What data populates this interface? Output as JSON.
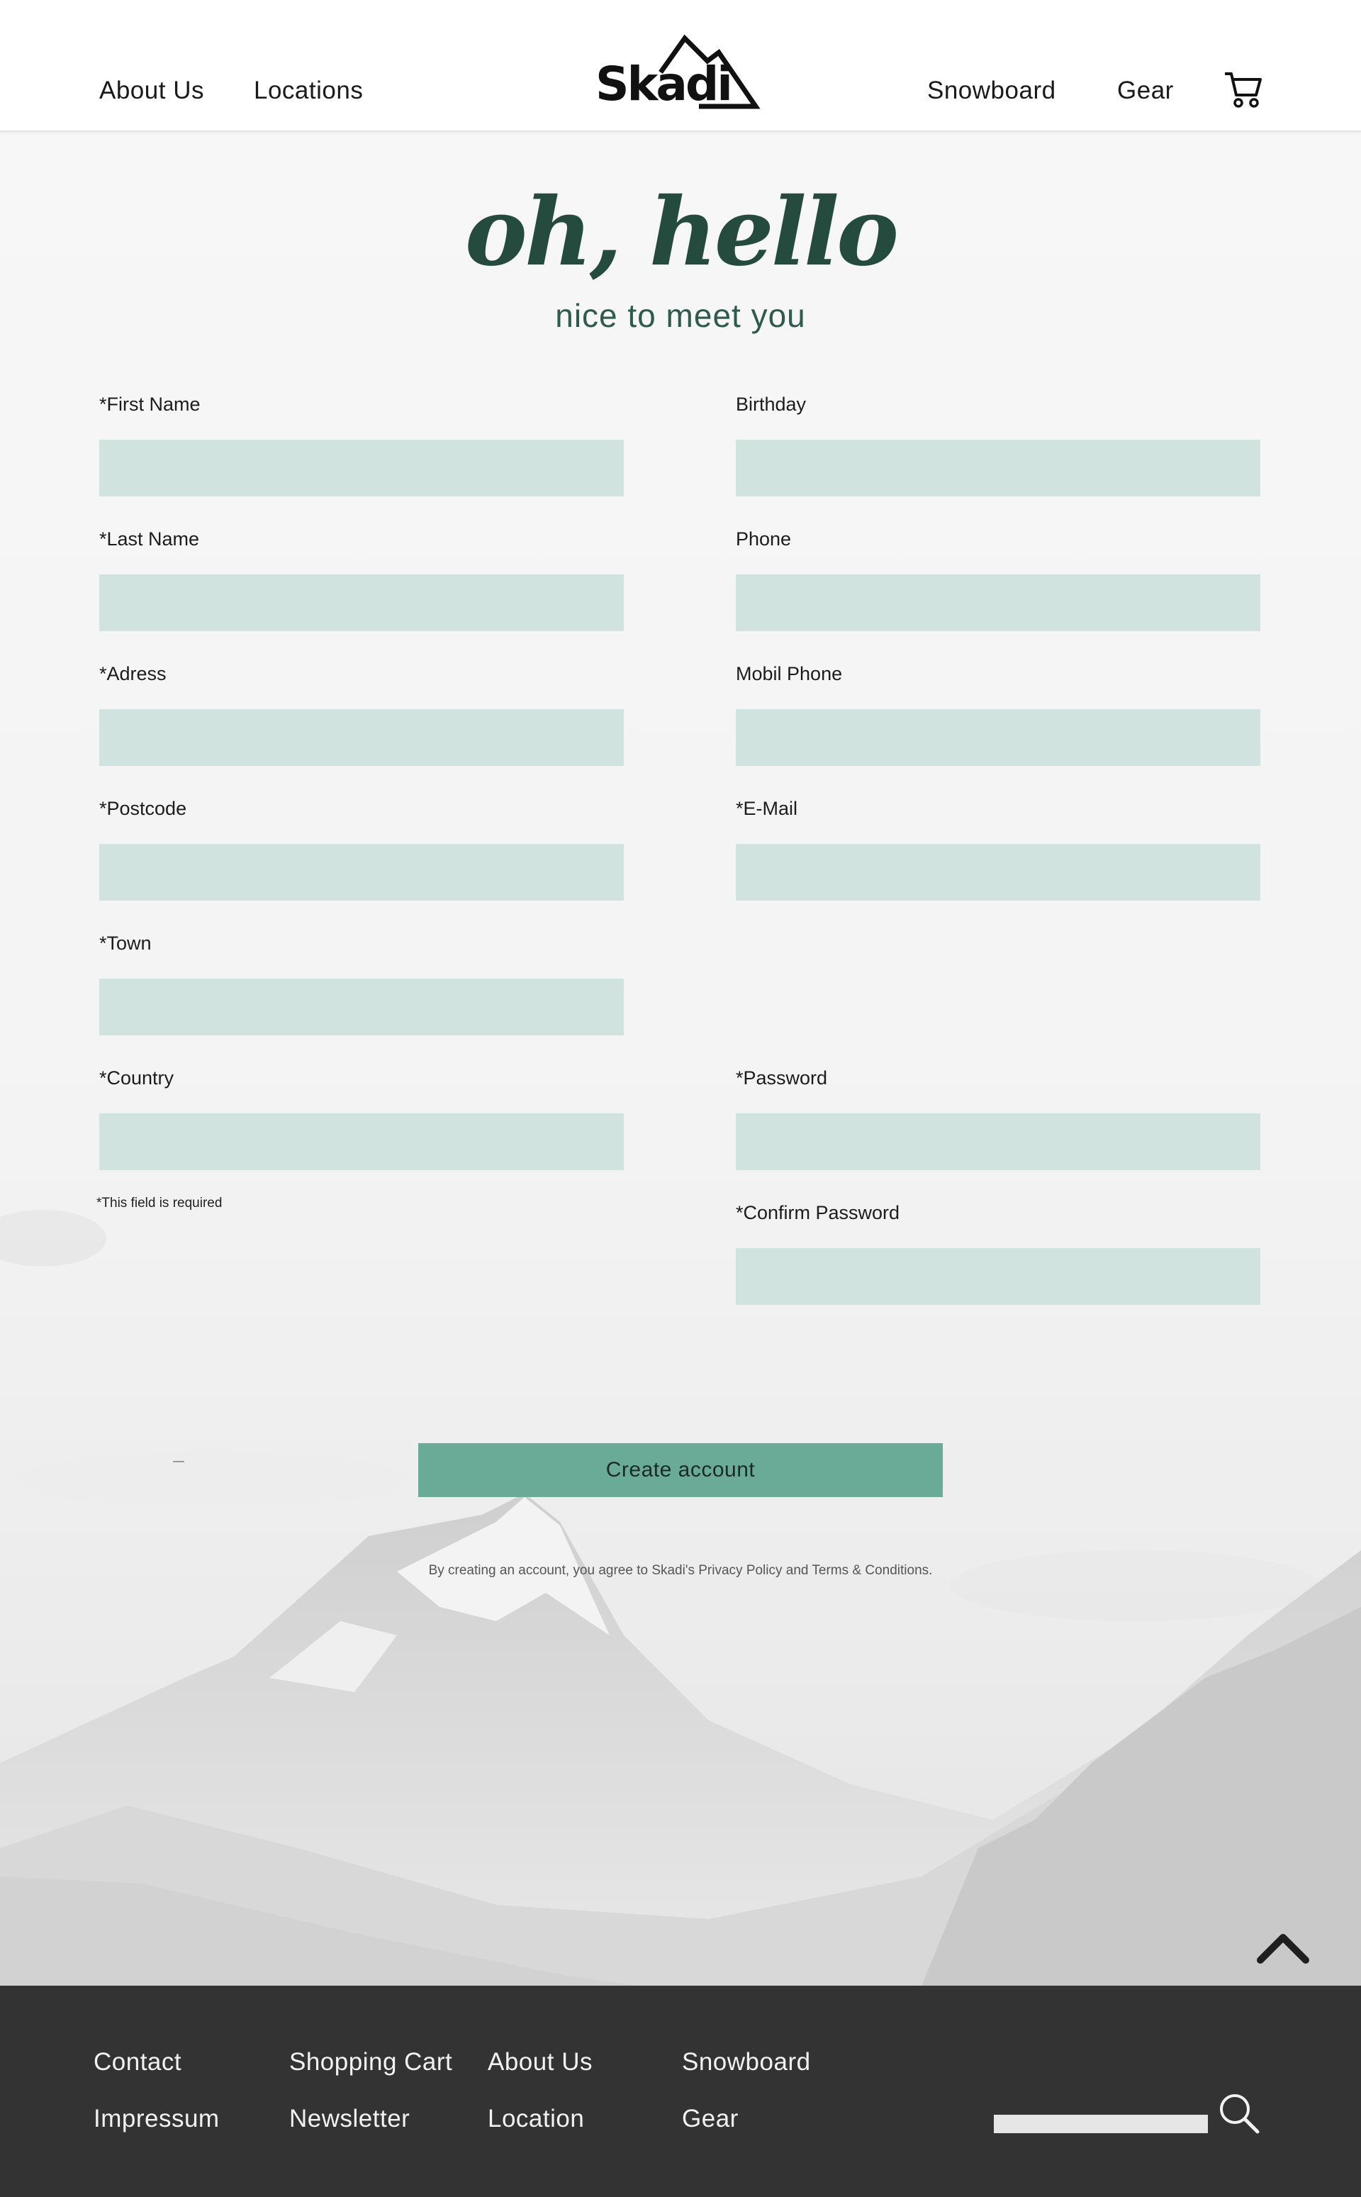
{
  "header": {
    "nav_left": [
      "About Us",
      "Locations"
    ],
    "logo_text": "Skadi",
    "nav_right": [
      "Snowboard",
      "Gear"
    ],
    "cart_icon": "shopping-cart-icon"
  },
  "hero": {
    "title": "oh, hello",
    "subtitle": "nice to meet you"
  },
  "form": {
    "first_name": "*First Name",
    "last_name": "*Last Name",
    "address": "*Adress",
    "postcode": "*Postcode",
    "town": "*Town",
    "country": "*Country",
    "birthday": "Birthday",
    "phone": "Phone",
    "mobile": "Mobil Phone",
    "email": "*E-Mail",
    "password": "*Password",
    "confirm_password": "*Confirm Password",
    "required_note": "*This field is required",
    "submit_label": "Create account",
    "terms": "By creating an account, you agree to Skadi's Privacy Policy and Terms & Conditions."
  },
  "footer": {
    "links": [
      "Contact",
      "Shopping Cart",
      "About Us",
      "Snowboard",
      "Impressum",
      "Newsletter",
      "Location",
      "Gear"
    ],
    "search_icon": "search-icon",
    "back_to_top_icon": "chevron-up-icon"
  },
  "colors": {
    "accent": "#6aab98",
    "input_fill": "#d1e3de",
    "heading": "#254b3f",
    "footer_bg": "#333333"
  }
}
